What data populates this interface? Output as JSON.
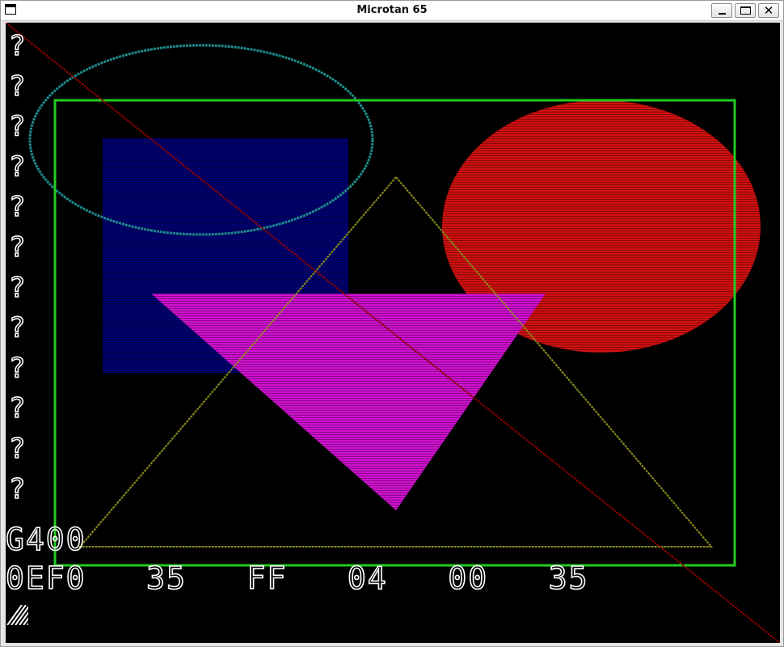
{
  "window": {
    "title": "Microtan 65",
    "controls": {
      "minimize_icon": "minimize-icon",
      "maximize_icon": "maximize-icon",
      "close_icon": "close-icon",
      "close_glyph": "✕"
    }
  },
  "screen": {
    "background": "#000000",
    "prompts": [
      "?",
      "?",
      "?",
      "?",
      "?",
      "?",
      "?",
      "?",
      "?",
      "?",
      "?",
      "?"
    ],
    "command_line": "G400",
    "register_line": "0EF0   35   FF   04   00   35",
    "cursor_icon": "block-cursor-icon"
  },
  "graphics": {
    "colors": {
      "border_rect": "#22cc22",
      "ellipse_outline": "#1e8c8c",
      "blue_square": "#000070",
      "magenta_triangle": "#d010d0",
      "red_ellipse": "#d01010",
      "olive_triangle": "#8c8c1e",
      "diagonal_line": "#8c0000"
    }
  }
}
